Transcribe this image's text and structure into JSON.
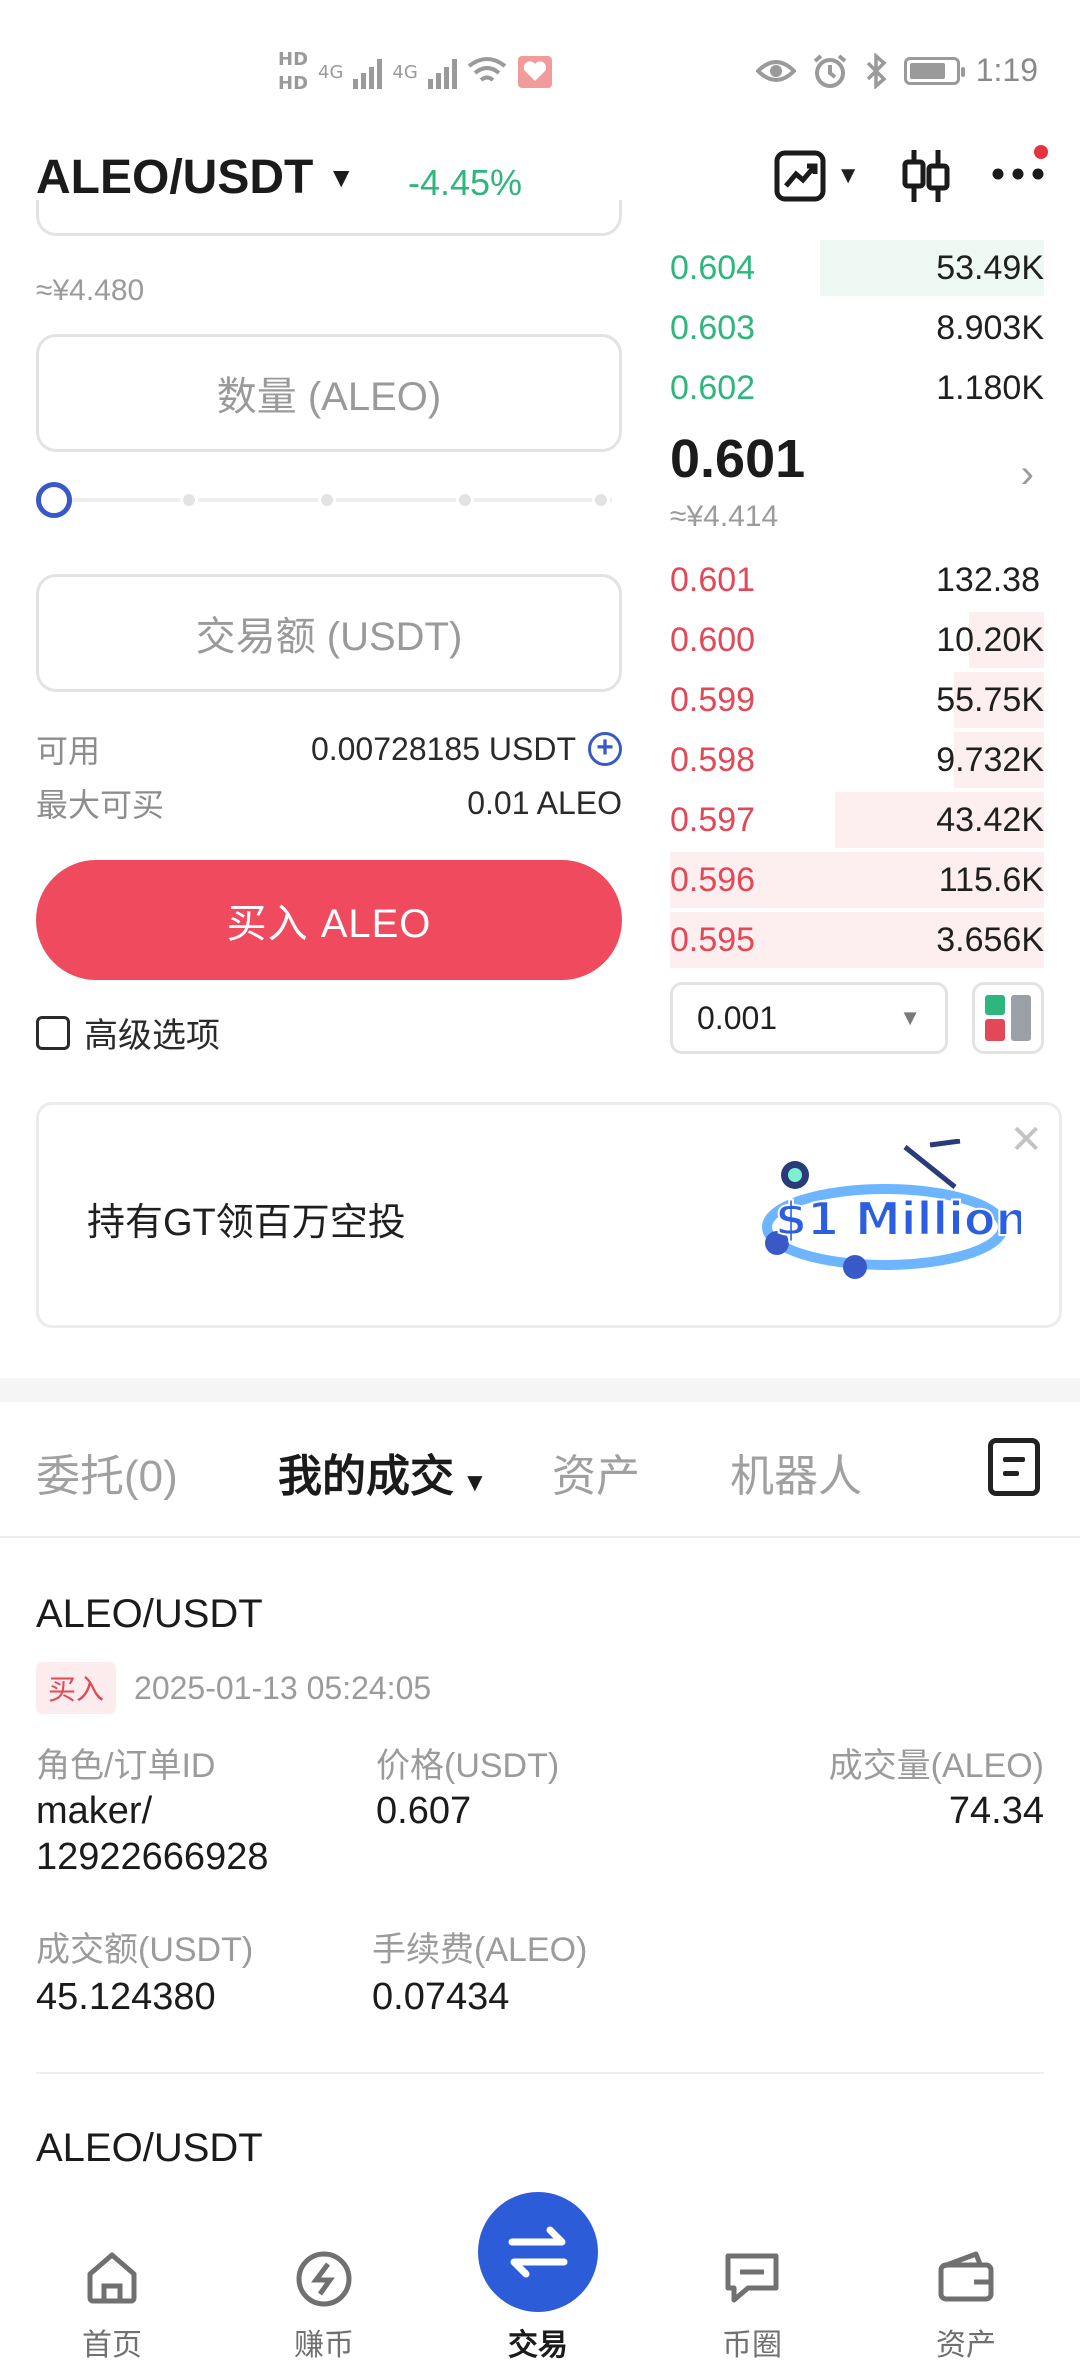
{
  "status_bar": {
    "hd1": "HD",
    "hd2": "HD",
    "net1": "4G",
    "net2": "4G",
    "time": "1:19"
  },
  "header": {
    "pair": "ALEO/USDT",
    "change": "-4.45%"
  },
  "form": {
    "price_cny_approx": "≈¥4.480",
    "quantity_placeholder": "数量 (ALEO)",
    "amount_placeholder": "交易额 (USDT)",
    "slider_percent": 0,
    "available_label": "可用",
    "available_value": "0.00728185 USDT",
    "max_buy_label": "最大可买",
    "max_buy_value": "0.01 ALEO",
    "buy_button": "买入 ALEO",
    "advanced_label": "高级选项",
    "advanced_checked": false
  },
  "order_book": {
    "asks_top": [
      {
        "price": "0.604",
        "qty": "53.49K"
      },
      {
        "price": "0.603",
        "qty": "8.903K"
      },
      {
        "price": "0.602",
        "qty": "1.180K"
      }
    ],
    "last_price": "0.601",
    "last_price_cny": "≈¥4.414",
    "bids": [
      {
        "price": "0.601",
        "qty": "132.38"
      },
      {
        "price": "0.600",
        "qty": "10.20K"
      },
      {
        "price": "0.599",
        "qty": "55.75K"
      },
      {
        "price": "0.598",
        "qty": "9.732K"
      },
      {
        "price": "0.597",
        "qty": "43.42K"
      },
      {
        "price": "0.596",
        "qty": "115.6K"
      },
      {
        "price": "0.595",
        "qty": "3.656K"
      }
    ],
    "precision": "0.001"
  },
  "banner": {
    "text": "持有GT领百万空投",
    "art_text": "$1 Million"
  },
  "tabs": {
    "orders": "委托(0)",
    "my_trades": "我的成交",
    "assets": "资产",
    "bots": "机器人"
  },
  "trades": [
    {
      "pair": "ALEO/USDT",
      "side": "买入",
      "time": "2025-01-13 05:24:05",
      "role_label": "角色/订单ID",
      "role_line1": "maker/",
      "role_line2": "12922666928",
      "price_label": "价格(USDT)",
      "price": "0.607",
      "volume_label": "成交量(ALEO)",
      "volume": "74.34",
      "turnover_label": "成交额(USDT)",
      "turnover": "45.124380",
      "fee_label": "手续费(ALEO)",
      "fee": "0.07434"
    },
    {
      "pair": "ALEO/USDT"
    }
  ],
  "bottom_nav": {
    "home": "首页",
    "earn": "赚币",
    "trade": "交易",
    "square": "币圈",
    "assets": "资产"
  },
  "colors": {
    "up": "#2eb67d",
    "down": "#e24856",
    "buy_button": "#f04a5e",
    "accent_blue": "#2d5cd9"
  }
}
